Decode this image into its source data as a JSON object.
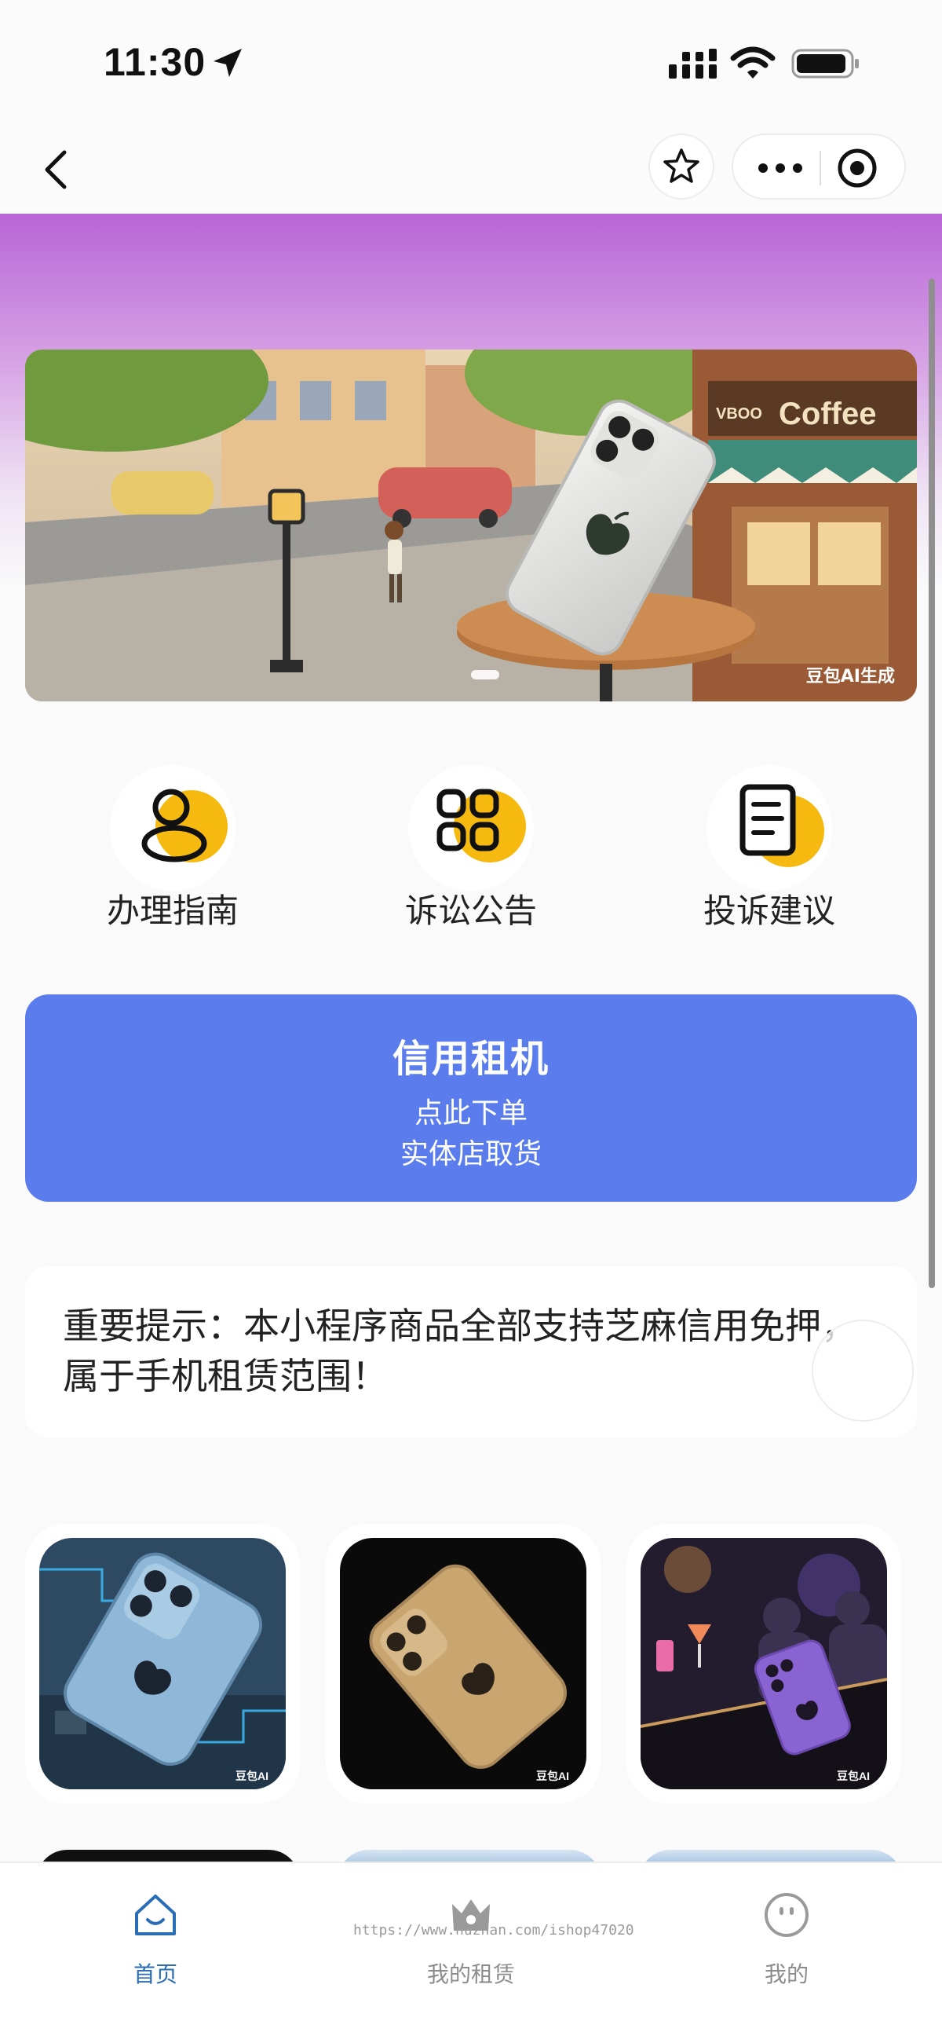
{
  "status_bar": {
    "time": "11:30"
  },
  "nav": {
    "back_icon": "chevron-left-icon",
    "favorite_icon": "star-icon",
    "more_icon": "more-dots-icon",
    "close_icon": "target-circle-icon"
  },
  "banner": {
    "ai_tag": "豆包AI生成",
    "shop_sign": "Coffee",
    "shop_sign_prefix": "VBOO",
    "page_indicator_count": 1
  },
  "quick_actions": [
    {
      "label": "办理指南",
      "icon": "person-icon"
    },
    {
      "label": "诉讼公告",
      "icon": "grid-icon"
    },
    {
      "label": "投诉建议",
      "icon": "document-icon"
    }
  ],
  "cta": {
    "title": "信用租机",
    "line1": "点此下单",
    "line2": "实体店取货"
  },
  "notice": {
    "text": "重要提示：本小程序商品全部支持芝麻信用免押，属于手机租赁范围！"
  },
  "products": [
    {
      "name": "blue-phone-on-circuit-board",
      "tag": "豆包AI"
    },
    {
      "name": "gold-phone-on-black",
      "tag": "豆包AI"
    },
    {
      "name": "purple-phone-on-bar-counter",
      "tag": "豆包AI"
    }
  ],
  "watermark": "https://www.huzhan.com/ishop47020",
  "tab_bar": {
    "tabs": [
      {
        "label": "首页",
        "icon": "home-icon",
        "active": true
      },
      {
        "label": "我的租赁",
        "icon": "crown-icon",
        "active": false
      },
      {
        "label": "我的",
        "icon": "smiley-icon",
        "active": false
      }
    ],
    "active_color": "#2a6db5",
    "inactive_color": "#8c8c8c"
  },
  "colors": {
    "cta_blue": "#5a7ced",
    "header_purple": "#b865d6",
    "icon_yellow": "#f5b90f"
  }
}
